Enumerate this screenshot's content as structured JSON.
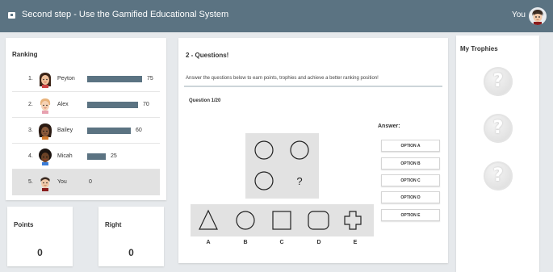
{
  "header": {
    "title": "Second step - Use the Gamified Educational System",
    "user_label": "You",
    "colors": {
      "bar": "#5b7382"
    }
  },
  "ranking": {
    "title": "Ranking",
    "rows": [
      {
        "pos": "1.",
        "name": "Peyton",
        "score": 75,
        "score_label": "75",
        "bar_fraction": 0.75,
        "avatar": "avatar-peyton-icon"
      },
      {
        "pos": "2.",
        "name": "Alex",
        "score": 70,
        "score_label": "70",
        "bar_fraction": 0.7,
        "avatar": "avatar-alex-icon"
      },
      {
        "pos": "3.",
        "name": "Bailey",
        "score": 60,
        "score_label": "60",
        "bar_fraction": 0.6,
        "avatar": "avatar-bailey-icon"
      },
      {
        "pos": "4.",
        "name": "Micah",
        "score": 25,
        "score_label": "25",
        "bar_fraction": 0.25,
        "avatar": "avatar-micah-icon"
      },
      {
        "pos": "5.",
        "name": "You",
        "score": 0,
        "score_label": "0",
        "bar_fraction": 0,
        "avatar": "avatar-you-icon"
      }
    ]
  },
  "points": {
    "label": "Points",
    "value": "0"
  },
  "right": {
    "label": "Right",
    "value": "0"
  },
  "questions": {
    "title": "2 - Questions!",
    "instructions": "Answer the questions below to earn points, trophies and achieve a better ranking position!",
    "question_number": "Question 1/20",
    "grid_missing": "?",
    "option_letters": [
      "A",
      "B",
      "C",
      "D",
      "E"
    ],
    "answer_title": "Answer:",
    "answers": [
      "OPTION A",
      "OPTION B",
      "OPTION C",
      "OPTION D",
      "OPTION E"
    ]
  },
  "trophies": {
    "title": "My Trophies",
    "items": [
      {
        "icon": "locked-trophy-icon",
        "glyph": "?"
      },
      {
        "icon": "locked-trophy-icon",
        "glyph": "?"
      },
      {
        "icon": "locked-trophy-icon",
        "glyph": "?"
      }
    ]
  }
}
